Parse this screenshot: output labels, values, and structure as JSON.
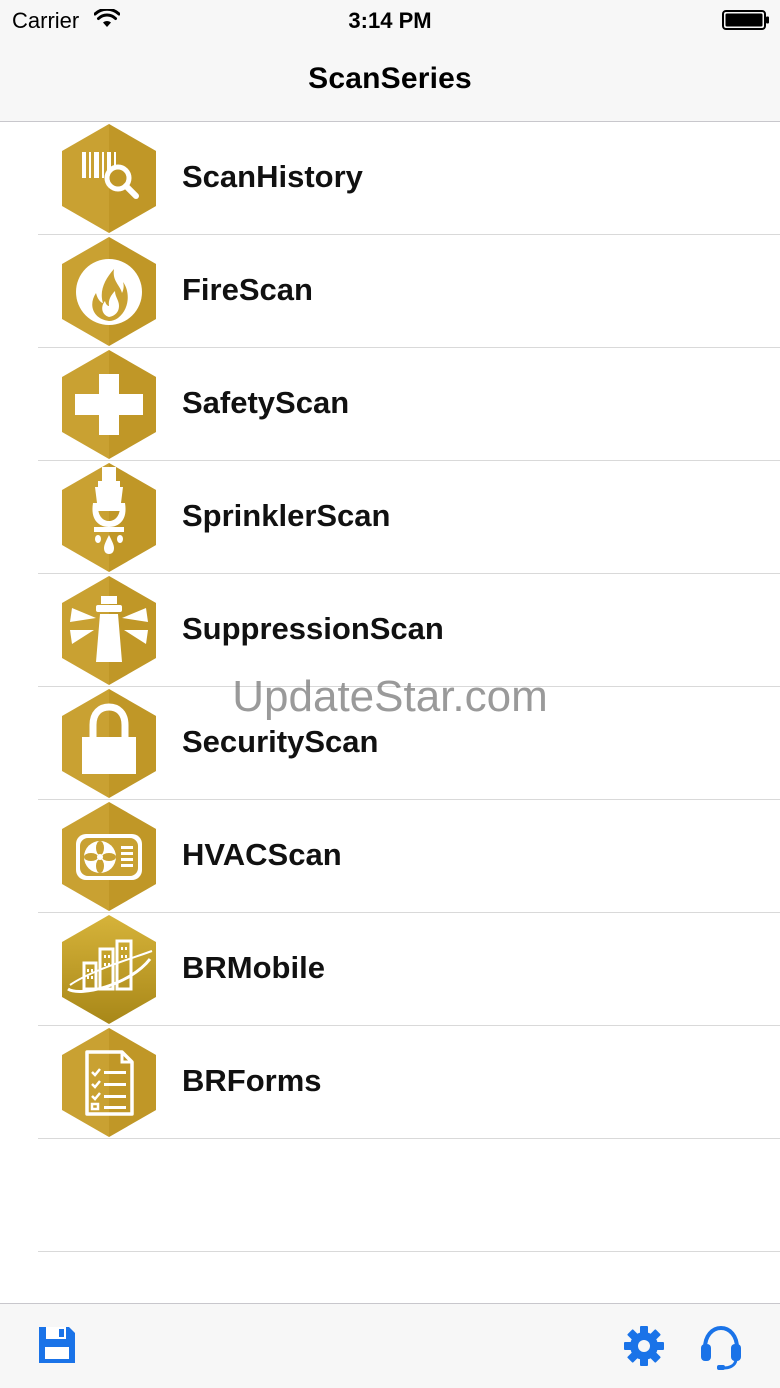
{
  "status_bar": {
    "carrier": "Carrier",
    "time": "3:14 PM",
    "wifi_icon": "wifi-icon",
    "battery_icon": "battery-icon"
  },
  "nav": {
    "title": "ScanSeries"
  },
  "colors": {
    "hex_gold": "#c9a132",
    "hex_gold_dark": "#a9821f",
    "tint_blue": "#1a73e8"
  },
  "list": {
    "items": [
      {
        "label": "ScanHistory",
        "icon": "scan-history-icon"
      },
      {
        "label": "FireScan",
        "icon": "fire-icon"
      },
      {
        "label": "SafetyScan",
        "icon": "plus-cross-icon"
      },
      {
        "label": "SprinklerScan",
        "icon": "sprinkler-icon"
      },
      {
        "label": "SuppressionScan",
        "icon": "suppression-nozzle-icon"
      },
      {
        "label": "SecurityScan",
        "icon": "padlock-icon"
      },
      {
        "label": "HVACScan",
        "icon": "hvac-fan-icon"
      },
      {
        "label": "BRMobile",
        "icon": "buildings-icon"
      },
      {
        "label": "BRForms",
        "icon": "document-checklist-icon"
      }
    ]
  },
  "watermark": "UpdateStar.com",
  "tab_bar": {
    "save_icon": "floppy-disk-icon",
    "settings_icon": "gear-icon",
    "support_icon": "headset-icon"
  }
}
